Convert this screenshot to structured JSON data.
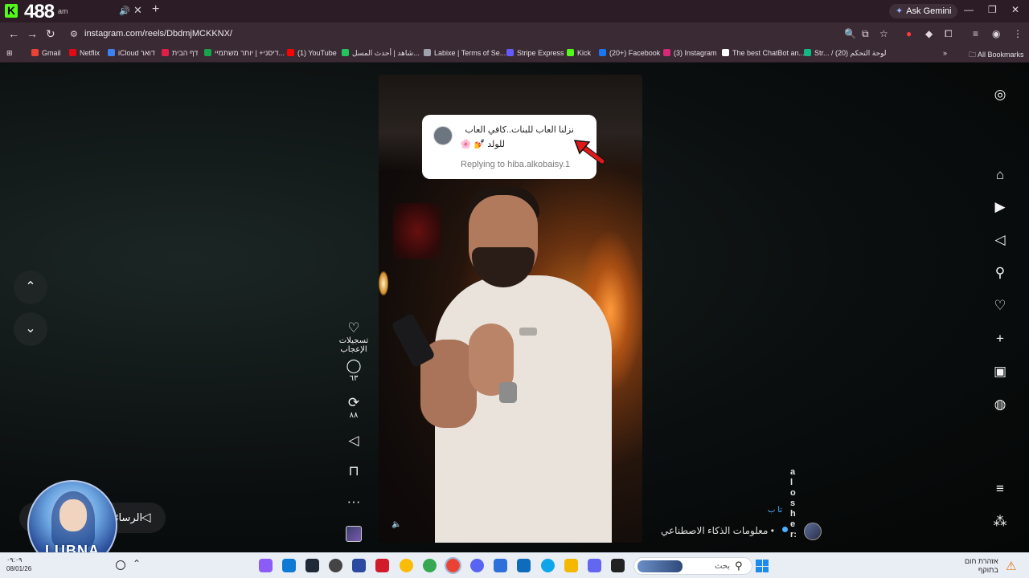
{
  "browser": {
    "overlay_count": "488",
    "tab_subtitle": "am",
    "ask_gemini": "Ask Gemini",
    "url": "instagram.com/reels/DbdmjMCKKNX/",
    "bookmarks": [
      {
        "label": "Gmail",
        "color": "#ea4335"
      },
      {
        "label": "Netflix",
        "color": "#e50914"
      },
      {
        "label": "iCloud דואר",
        "color": "#3b82f6"
      },
      {
        "label": "דף הבית",
        "color": "#e11d48"
      },
      {
        "label": "דיסני+ | יותר משתמיי...",
        "color": "#16a34a"
      },
      {
        "label": "(1) YouTube",
        "color": "#ff0000"
      },
      {
        "label": "شاهد | أحدث المسل...",
        "color": "#22c55e"
      },
      {
        "label": "Labixe | Terms of Se...",
        "color": "#9ca3af"
      },
      {
        "label": "Stripe Express",
        "color": "#635bff"
      },
      {
        "label": "Kick",
        "color": "#53fc18"
      },
      {
        "label": "(20+) Facebook",
        "color": "#1877f2"
      },
      {
        "label": "(3) Instagram",
        "color": "#d62976"
      },
      {
        "label": "The best ChatBot an...",
        "color": "#ffffff"
      },
      {
        "label": "Str... / لوحة التحكم (20)",
        "color": "#10b981"
      }
    ],
    "all_bookmarks": "All Bookmarks"
  },
  "reel": {
    "comment_line1": "نزلنا العاب للبنات..كافي العاب",
    "comment_line2": "للولد 💅 🌸",
    "replying_to": "Replying to hiba.alkobaisy.1"
  },
  "actions": {
    "likes_label": "تسجيلات الإعجاب",
    "comments_count": "٦٣",
    "reposts_count": "٨٨"
  },
  "author": {
    "caption": "معلومات الذكاء الاصطناعي •",
    "vertical_name": "alosher:",
    "vertical_small": "تا ب"
  },
  "messages": {
    "label": "الرسائل"
  },
  "overlay_badge": {
    "name": "LUBNA"
  },
  "taskbar": {
    "clock": "٠٩:٠٩",
    "date": "08/01/26",
    "search_placeholder": "بحث",
    "weather_line1": "אזהרת חום",
    "weather_line2": "בתוקף"
  },
  "colors": {
    "tab_bg": "#2b1c26",
    "toolbar_bg": "#3a2a34",
    "accent_blue": "#4ab0ff"
  }
}
